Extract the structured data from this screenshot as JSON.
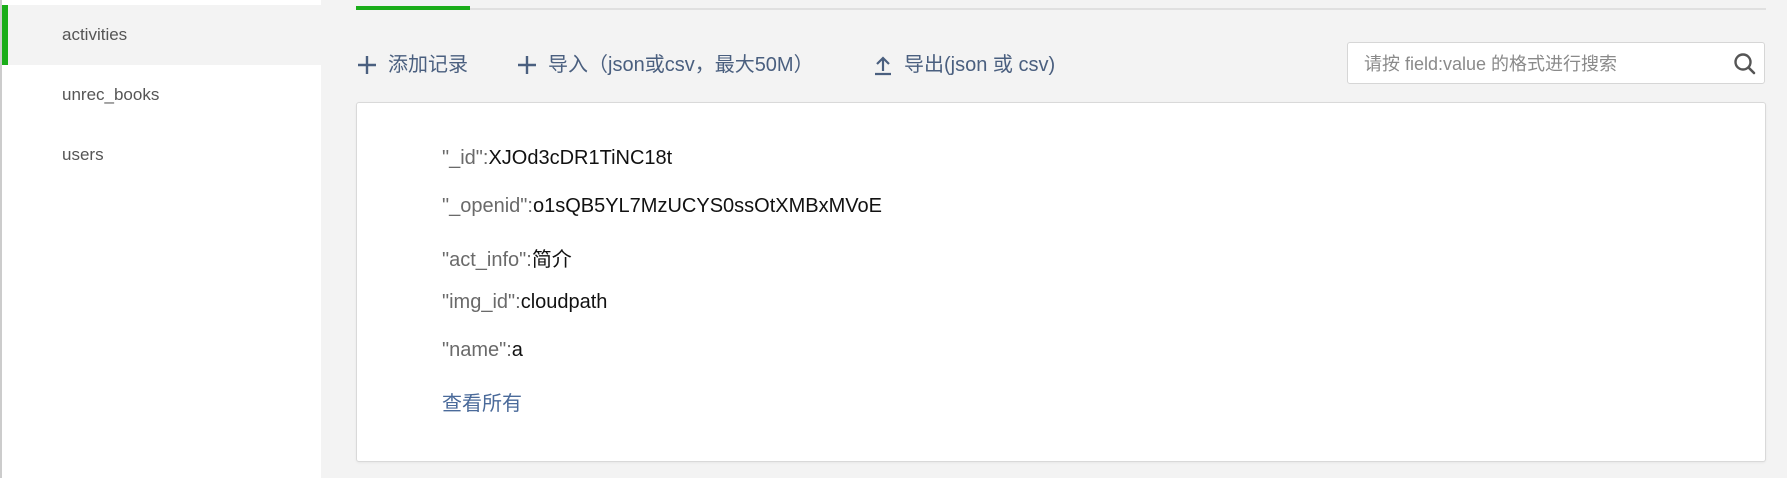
{
  "sidebar": {
    "items": [
      {
        "label": "activities",
        "active": true
      },
      {
        "label": "unrec_books",
        "active": false
      },
      {
        "label": "users",
        "active": false
      }
    ]
  },
  "toolbar": {
    "add_label": "添加记录",
    "import_label": "导入（json或csv，最大50M）",
    "export_label": "导出(json 或 csv)"
  },
  "search": {
    "placeholder": "请按 field:value 的格式进行搜索",
    "value": ""
  },
  "record": {
    "fields": [
      {
        "key": "\"_id\"",
        "value": "XJOd3cDR1TiNC18t"
      },
      {
        "key": "\"_openid\"",
        "value": "o1sQB5YL7MzUCYS0ssOtXMBxMVoE"
      },
      {
        "key": "\"act_info\"",
        "value": "简介"
      },
      {
        "key": "\"img_id\"",
        "value": "cloudpath"
      },
      {
        "key": "\"name\"",
        "value": "a"
      }
    ],
    "view_all_label": "查看所有"
  },
  "colors": {
    "accent": "#1aad19",
    "toolbar_text": "#4a5f7f",
    "link": "#4a6a9a",
    "background": "#f3f3f3"
  },
  "icons": {
    "add": "plus-icon",
    "import": "plus-icon",
    "export": "upload-icon",
    "search": "search-icon"
  }
}
